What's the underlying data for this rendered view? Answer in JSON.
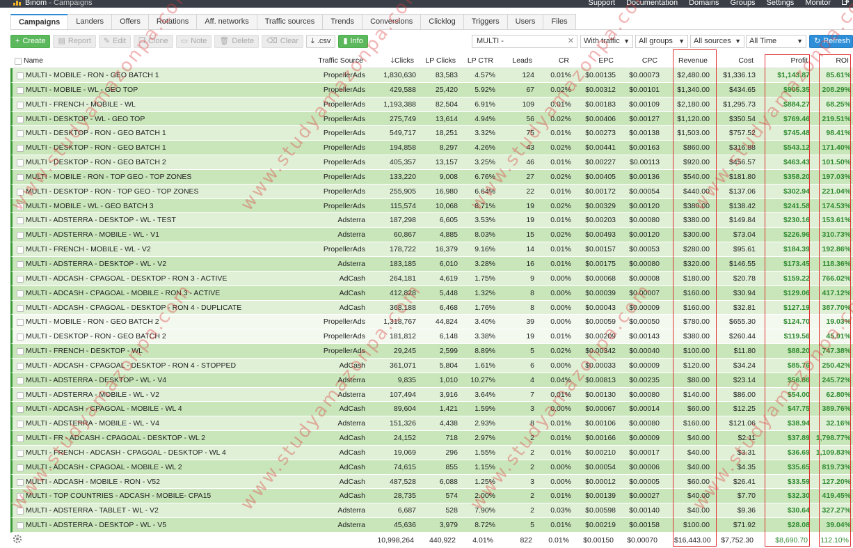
{
  "app": {
    "name": "Binom",
    "separator": " - ",
    "page": "Campaigns"
  },
  "top_nav": [
    "Support",
    "Documentation",
    "Domains",
    "Groups",
    "Settings",
    "Monitor"
  ],
  "tabs": [
    "Campaigns",
    "Landers",
    "Offers",
    "Rotations",
    "Aff. networks",
    "Traffic sources",
    "Trends",
    "Conversions",
    "Clicklog",
    "Triggers",
    "Users",
    "Files"
  ],
  "active_tab": "Campaigns",
  "toolbar": {
    "create": "Create",
    "report": "Report",
    "edit": "Edit",
    "clone": "Clone",
    "note": "Note",
    "delete": "Delete",
    "clear": "Clear",
    "csv": ".csv",
    "info": "Info",
    "refresh": "Refresh"
  },
  "filters": {
    "search_value": "MULTI -",
    "traffic": "With traffic",
    "groups": "All groups",
    "sources": "All sources",
    "period": "All Time"
  },
  "columns": {
    "name": "Name",
    "traffic_source": "Traffic Source",
    "clicks": "Clicks",
    "lp_clicks": "LP Clicks",
    "lp_ctr": "LP CTR",
    "leads": "Leads",
    "cr": "CR",
    "epc": "EPC",
    "cpc": "CPC",
    "revenue": "Revenue",
    "cost": "Cost",
    "profit": "Profit",
    "roi": "ROI"
  },
  "rows": [
    [
      "MULTI - MOBILE - RON - GEO BATCH 1",
      "PropellerAds",
      "1,830,630",
      "83,583",
      "4.57%",
      "124",
      "0.01%",
      "$0.00135",
      "$0.00073",
      "$2,480.00",
      "$1,336.13",
      "$1,143.87",
      "85.61%"
    ],
    [
      "MULTI - MOBILE - WL - GEO TOP",
      "PropellerAds",
      "429,588",
      "25,420",
      "5.92%",
      "67",
      "0.02%",
      "$0.00312",
      "$0.00101",
      "$1,340.00",
      "$434.65",
      "$905.35",
      "208.29%"
    ],
    [
      "MULTI - FRENCH - MOBILE - WL",
      "PropellerAds",
      "1,193,388",
      "82,504",
      "6.91%",
      "109",
      "0.01%",
      "$0.00183",
      "$0.00109",
      "$2,180.00",
      "$1,295.73",
      "$884.27",
      "68.25%"
    ],
    [
      "MULTI - DESKTOP - WL - GEO TOP",
      "PropellerAds",
      "275,749",
      "13,614",
      "4.94%",
      "56",
      "0.02%",
      "$0.00406",
      "$0.00127",
      "$1,120.00",
      "$350.54",
      "$769.46",
      "219.51%"
    ],
    [
      "MULTI - DESKTOP - RON - GEO BATCH 1",
      "PropellerAds",
      "549,717",
      "18,251",
      "3.32%",
      "75",
      "0.01%",
      "$0.00273",
      "$0.00138",
      "$1,503.00",
      "$757.52",
      "$745.48",
      "98.41%"
    ],
    [
      "MULTI - DESKTOP - RON - GEO BATCH 1",
      "PropellerAds",
      "194,858",
      "8,297",
      "4.26%",
      "43",
      "0.02%",
      "$0.00441",
      "$0.00163",
      "$860.00",
      "$316.88",
      "$543.12",
      "171.40%"
    ],
    [
      "MULTI - DESKTOP - RON - GEO BATCH 2",
      "PropellerAds",
      "405,357",
      "13,157",
      "3.25%",
      "46",
      "0.01%",
      "$0.00227",
      "$0.00113",
      "$920.00",
      "$456.57",
      "$463.43",
      "101.50%"
    ],
    [
      "MULTI - MOBILE - RON - TOP GEO - TOP ZONES",
      "PropellerAds",
      "133,220",
      "9,008",
      "6.76%",
      "27",
      "0.02%",
      "$0.00405",
      "$0.00136",
      "$540.00",
      "$181.80",
      "$358.20",
      "197.03%"
    ],
    [
      "MULTI - DESKTOP - RON - TOP GEO - TOP ZONES",
      "PropellerAds",
      "255,905",
      "16,980",
      "6.64%",
      "22",
      "0.01%",
      "$0.00172",
      "$0.00054",
      "$440.00",
      "$137.06",
      "$302.94",
      "221.04%"
    ],
    [
      "MULTI - MOBILE - WL - GEO BATCH 3",
      "PropellerAds",
      "115,574",
      "10,068",
      "8.71%",
      "19",
      "0.02%",
      "$0.00329",
      "$0.00120",
      "$380.00",
      "$138.42",
      "$241.58",
      "174.53%"
    ],
    [
      "MULTI - ADSTERRA - DESKTOP - WL - TEST",
      "Adsterra",
      "187,298",
      "6,605",
      "3.53%",
      "19",
      "0.01%",
      "$0.00203",
      "$0.00080",
      "$380.00",
      "$149.84",
      "$230.16",
      "153.61%"
    ],
    [
      "MULTI - ADSTERRA - MOBILE - WL - V1",
      "Adsterra",
      "60,867",
      "4,885",
      "8.03%",
      "15",
      "0.02%",
      "$0.00493",
      "$0.00120",
      "$300.00",
      "$73.04",
      "$226.96",
      "310.73%"
    ],
    [
      "MULTI - FRENCH - MOBILE - WL - V2",
      "PropellerAds",
      "178,722",
      "16,379",
      "9.16%",
      "14",
      "0.01%",
      "$0.00157",
      "$0.00053",
      "$280.00",
      "$95.61",
      "$184.39",
      "192.86%"
    ],
    [
      "MULTI - ADSTERRA - DESKTOP - WL - V2",
      "Adsterra",
      "183,185",
      "6,010",
      "3.28%",
      "16",
      "0.01%",
      "$0.00175",
      "$0.00080",
      "$320.00",
      "$146.55",
      "$173.45",
      "118.36%"
    ],
    [
      "MULTI - ADCASH - CPAGOAL - DESKTOP - RON 3 - ACTIVE",
      "AdCash",
      "264,181",
      "4,619",
      "1.75%",
      "9",
      "0.00%",
      "$0.00068",
      "$0.00008",
      "$180.00",
      "$20.78",
      "$159.22",
      "766.02%"
    ],
    [
      "MULTI - ADCASH - CPAGOAL - MOBILE - RON 3 - ACTIVE",
      "AdCash",
      "412,828",
      "5,448",
      "1.32%",
      "8",
      "0.00%",
      "$0.00039",
      "$0.00007",
      "$160.00",
      "$30.94",
      "$129.06",
      "417.12%"
    ],
    [
      "MULTI - ADCASH - CPAGOAL - DESKTOP - RON 4 - DUPLICATE",
      "AdCash",
      "368,188",
      "6,468",
      "1.76%",
      "8",
      "0.00%",
      "$0.00043",
      "$0.00009",
      "$160.00",
      "$32.81",
      "$127.19",
      "387.70%"
    ],
    [
      "MULTI - MOBILE - RON - GEO BATCH 2",
      "PropellerAds",
      "1,318,767",
      "44,824",
      "3.40%",
      "39",
      "0.00%",
      "$0.00059",
      "$0.00050",
      "$780.00",
      "$655.30",
      "$124.70",
      "19.03%"
    ],
    [
      "MULTI - DESKTOP - RON - GEO BATCH 2",
      "PropellerAds",
      "181,812",
      "6,148",
      "3.38%",
      "19",
      "0.01%",
      "$0.00209",
      "$0.00143",
      "$380.00",
      "$260.44",
      "$119.56",
      "45.91%"
    ],
    [
      "MULTI - FRENCH - DESKTOP - WL",
      "PropellerAds",
      "29,245",
      "2,599",
      "8.89%",
      "5",
      "0.02%",
      "$0.00342",
      "$0.00040",
      "$100.00",
      "$11.80",
      "$88.20",
      "747.38%"
    ],
    [
      "MULTI - ADCASH - CPAGOAL - DESKTOP - RON 4 - STOPPED",
      "AdCash",
      "361,071",
      "5,804",
      "1.61%",
      "6",
      "0.00%",
      "$0.00033",
      "$0.00009",
      "$120.00",
      "$34.24",
      "$85.76",
      "250.42%"
    ],
    [
      "MULTI - ADSTERRA - DESKTOP - WL - V4",
      "Adsterra",
      "9,835",
      "1,010",
      "10.27%",
      "4",
      "0.04%",
      "$0.00813",
      "$0.00235",
      "$80.00",
      "$23.14",
      "$56.86",
      "245.72%"
    ],
    [
      "MULTI - ADSTERRA - MOBILE - WL - V2",
      "Adsterra",
      "107,494",
      "3,916",
      "3.64%",
      "7",
      "0.01%",
      "$0.00130",
      "$0.00080",
      "$140.00",
      "$86.00",
      "$54.00",
      "62.80%"
    ],
    [
      "MULTI - ADCASH - CPAGOAL - MOBILE - WL 4",
      "AdCash",
      "89,604",
      "1,421",
      "1.59%",
      "3",
      "0.00%",
      "$0.00067",
      "$0.00014",
      "$60.00",
      "$12.25",
      "$47.75",
      "389.76%"
    ],
    [
      "MULTI - ADSTERRA - MOBILE - WL - V4",
      "Adsterra",
      "151,326",
      "4,438",
      "2.93%",
      "8",
      "0.01%",
      "$0.00106",
      "$0.00080",
      "$160.00",
      "$121.06",
      "$38.94",
      "32.16%"
    ],
    [
      "MULTI - FR - ADCASH - CPAGOAL - DESKTOP - WL 2",
      "AdCash",
      "24,152",
      "718",
      "2.97%",
      "2",
      "0.01%",
      "$0.00166",
      "$0.00009",
      "$40.00",
      "$2.11",
      "$37.89",
      "1,798.77%"
    ],
    [
      "MULTI - FRENCH - ADCASH - CPAGOAL - DESKTOP - WL 4",
      "AdCash",
      "19,069",
      "296",
      "1.55%",
      "2",
      "0.01%",
      "$0.00210",
      "$0.00017",
      "$40.00",
      "$3.31",
      "$36.69",
      "1,109.83%"
    ],
    [
      "MULTI - ADCASH - CPAGOAL - MOBILE - WL 2",
      "AdCash",
      "74,615",
      "855",
      "1.15%",
      "2",
      "0.00%",
      "$0.00054",
      "$0.00006",
      "$40.00",
      "$4.35",
      "$35.65",
      "819.73%"
    ],
    [
      "MULTI - ADCASH - MOBILE - RON - V52",
      "AdCash",
      "487,528",
      "6,088",
      "1.25%",
      "3",
      "0.00%",
      "$0.00012",
      "$0.00005",
      "$60.00",
      "$26.41",
      "$33.59",
      "127.20%"
    ],
    [
      "MULTI - TOP COUNTRIES - ADCASH - MOBILE- CPA15",
      "AdCash",
      "28,735",
      "574",
      "2.00%",
      "2",
      "0.01%",
      "$0.00139",
      "$0.00027",
      "$40.00",
      "$7.70",
      "$32.30",
      "419.45%"
    ],
    [
      "MULTI - ADSTERRA - TABLET - WL - V2",
      "Adsterra",
      "6,687",
      "528",
      "7.90%",
      "2",
      "0.03%",
      "$0.00598",
      "$0.00140",
      "$40.00",
      "$9.36",
      "$30.64",
      "327.27%"
    ],
    [
      "MULTI - ADSTERRA - DESKTOP - WL - V5",
      "Adsterra",
      "45,636",
      "3,979",
      "8.72%",
      "5",
      "0.01%",
      "$0.00219",
      "$0.00158",
      "$100.00",
      "$71.92",
      "$28.08",
      "39.04%"
    ]
  ],
  "totals": {
    "clicks": "10,998,264",
    "lp_clicks": "440,922",
    "lp_ctr": "4.01%",
    "leads": "822",
    "cr": "0.01%",
    "epc": "$0.00150",
    "cpc": "$0.00070",
    "revenue": "$16,443.00",
    "cost": "$7,752.30",
    "profit": "$8,690.70",
    "roi": "112.10%"
  },
  "watermark": "www.studyamazonpa.com",
  "colors": {
    "accent_blue": "#2e8fd8",
    "create_green": "#5cb85c",
    "profit_green": "#2f8a2f",
    "highlight_red": "#e03030"
  }
}
